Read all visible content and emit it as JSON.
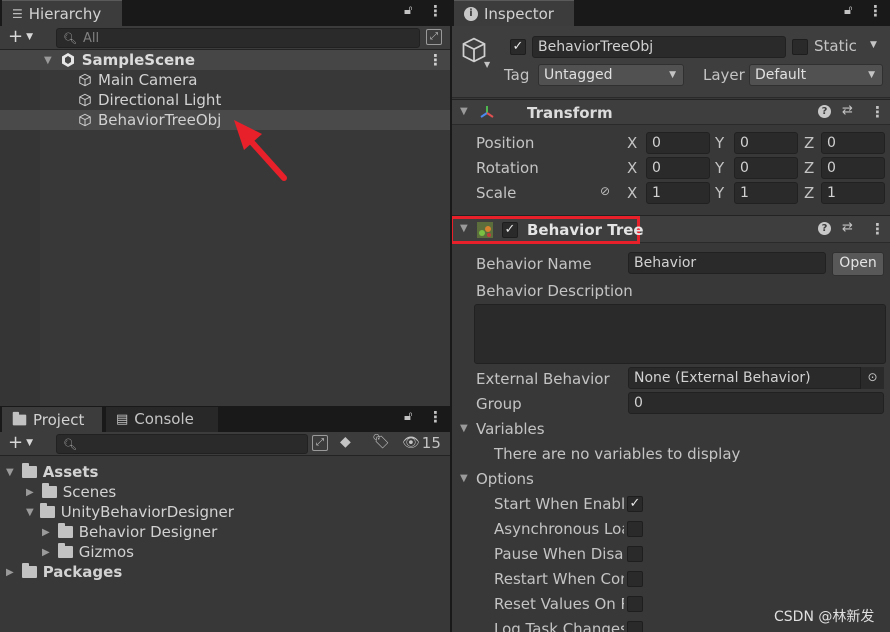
{
  "hierarchy": {
    "tab_label": "Hierarchy",
    "search_placeholder": "All",
    "scene_name": "SampleScene",
    "items": [
      {
        "label": "Main Camera"
      },
      {
        "label": "Directional Light"
      },
      {
        "label": "BehaviorTreeObj"
      }
    ]
  },
  "project": {
    "tab_label": "Project",
    "console_tab_label": "Console",
    "hidden_count": "15",
    "tree": [
      {
        "label": "Assets"
      },
      {
        "label": "Scenes"
      },
      {
        "label": "UnityBehaviorDesigner"
      },
      {
        "label": "Behavior Designer"
      },
      {
        "label": "Gizmos"
      },
      {
        "label": "Packages"
      }
    ]
  },
  "inspector": {
    "tab_label": "Inspector",
    "object_name": "BehaviorTreeObj",
    "static_label": "Static",
    "tag_label": "Tag",
    "tag_value": "Untagged",
    "layer_label": "Layer",
    "layer_value": "Default",
    "transform": {
      "title": "Transform",
      "position_label": "Position",
      "rotation_label": "Rotation",
      "scale_label": "Scale",
      "axes": [
        "X",
        "Y",
        "Z"
      ],
      "position": [
        "0",
        "0",
        "0"
      ],
      "rotation": [
        "0",
        "0",
        "0"
      ],
      "scale": [
        "1",
        "1",
        "1"
      ]
    },
    "behavior_tree": {
      "title": "Behavior Tree",
      "name_label": "Behavior Name",
      "name_value": "Behavior",
      "open_button": "Open",
      "description_label": "Behavior Description",
      "external_label": "External Behavior",
      "external_value": "None (External Behavior)",
      "group_label": "Group",
      "group_value": "0",
      "variables_label": "Variables",
      "variables_empty": "There are no variables to display",
      "options_label": "Options",
      "options": [
        {
          "label": "Start When Enable",
          "checked": true
        },
        {
          "label": "Asynchronous Loa",
          "checked": false
        },
        {
          "label": "Pause When Disal",
          "checked": false
        },
        {
          "label": "Restart When Com",
          "checked": false
        },
        {
          "label": "Reset Values On R",
          "checked": false
        },
        {
          "label": "Log Task Changes",
          "checked": false
        }
      ]
    }
  },
  "watermark": "CSDN @林新发",
  "colors": {
    "annotation": "#e8202a",
    "selection": "#464646",
    "panel": "#383838"
  }
}
